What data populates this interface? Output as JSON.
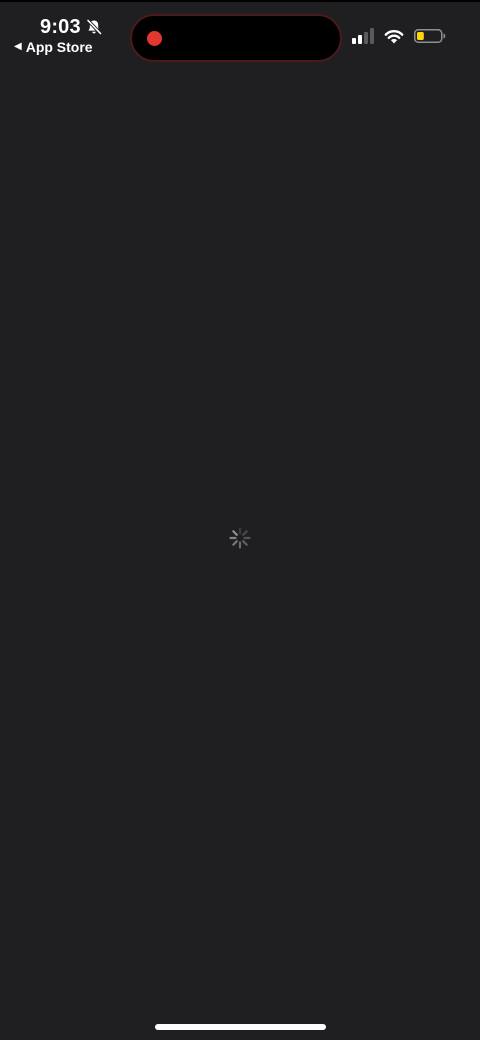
{
  "status_bar": {
    "time": "9:03",
    "back_label": "App Store",
    "icons": {
      "silent": "bell-slash-icon",
      "signal": "cellular-signal-icon",
      "wifi": "wifi-icon",
      "battery": "battery-icon",
      "recording": "screen-recording-dot-icon",
      "back": "back-chevron-icon"
    },
    "signal_bars_active": 2,
    "signal_bars_total": 4,
    "battery_level": 0.3
  },
  "main": {
    "state": "loading",
    "indicator": "activity-spinner-icon"
  },
  "colors": {
    "background": "#1f1e21",
    "text": "#ffffff",
    "recording_dot": "#e0382e",
    "battery_fill": "#ffd60a",
    "spinner": "#8e8e93"
  }
}
